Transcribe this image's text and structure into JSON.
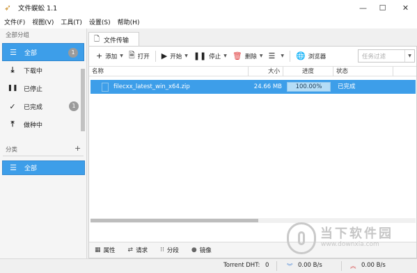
{
  "window": {
    "title": "文件蜈蚣 1.1",
    "minimize": "—",
    "maximize": "☐",
    "close": "✕"
  },
  "menu": [
    "文件(F)",
    "视图(V)",
    "工具(T)",
    "设置(S)",
    "帮助(H)"
  ],
  "sidebar": {
    "group_header": "全部分组",
    "items": [
      {
        "label": "全部",
        "icon": "list-icon",
        "glyph": "☰",
        "badge": "1",
        "active": true
      },
      {
        "label": "下载中",
        "icon": "download-icon",
        "glyph": "⤓",
        "badge": "",
        "active": false
      },
      {
        "label": "已停止",
        "icon": "pause-icon",
        "glyph": "❚❚",
        "badge": "",
        "active": false
      },
      {
        "label": "已完成",
        "icon": "check-icon",
        "glyph": "✓",
        "badge": "1",
        "active": false
      },
      {
        "label": "做种中",
        "icon": "upload-icon",
        "glyph": "⤒",
        "badge": "",
        "active": false
      }
    ],
    "category_header": "分类",
    "category_add": "+",
    "category_items": [
      {
        "label": "全部",
        "icon": "list-icon",
        "glyph": "☰",
        "active": true
      }
    ]
  },
  "tab": {
    "label": "文件传输",
    "icon": "file-icon"
  },
  "toolbar": {
    "add": "添加",
    "open": "打开",
    "start": "开始",
    "stop": "停止",
    "delete": "删除",
    "more": "",
    "browser": "浏览器",
    "filter_placeholder": "任务过滤"
  },
  "table": {
    "columns": [
      "名称",
      "大小",
      "进度",
      "状态"
    ],
    "rows": [
      {
        "name": "filecxx_latest_win_x64.zip",
        "size": "24.66 MB",
        "progress": "100.00%",
        "progress_value": 1.0,
        "status": "已完成",
        "selected": true
      }
    ]
  },
  "bottom_tabs": [
    {
      "label": "属性",
      "icon": "properties-icon",
      "glyph": "▦"
    },
    {
      "label": "请求",
      "icon": "transfer-icon",
      "glyph": "⇄"
    },
    {
      "label": "分段",
      "icon": "segments-icon",
      "glyph": "⁝⁝"
    },
    {
      "label": "镜像",
      "icon": "mirror-icon",
      "glyph": "●"
    }
  ],
  "statusbar": {
    "dht_label": "Torrent DHT:",
    "dht_value": "0",
    "down_speed": "0.00 B/s",
    "up_speed": "0.00 B/s"
  },
  "watermark": {
    "brand": "当下软件园",
    "url": "www.downxia.com"
  },
  "colors": {
    "accent": "#3d9ee9",
    "badge": "#9b9b9b",
    "delete": "#e04040",
    "down_speed": "#3d7fd6",
    "up_speed": "#d84a4a"
  }
}
